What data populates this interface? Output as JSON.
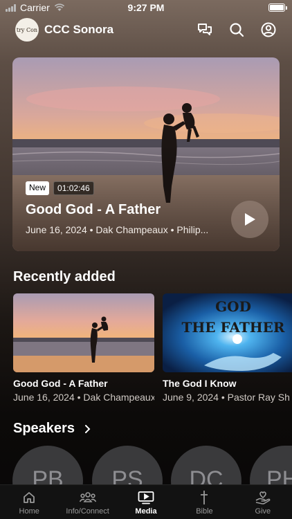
{
  "status_bar": {
    "carrier": "Carrier",
    "time": "9:27 PM",
    "battery_level": 1.0
  },
  "header": {
    "logo_text": "try Con",
    "title": "CCC Sonora",
    "icons": [
      "chat-icon",
      "search-icon",
      "profile-icon"
    ]
  },
  "featured": {
    "badge": "New",
    "duration": "01:02:46",
    "title": "Good God - A Father",
    "meta": "June 16, 2024 • Dak Champeaux • Philip..."
  },
  "recently_added": {
    "heading": "Recently added",
    "items": [
      {
        "title": "Good God - A Father",
        "meta": "June 16, 2024 • Dak Champeaux"
      },
      {
        "title": "The God I Know",
        "meta": "June 9, 2024 • Pastor Ray Sh",
        "thumb_text_line1": "GOD",
        "thumb_text_line2": "THE FATHER"
      }
    ]
  },
  "speakers": {
    "heading": "Speakers",
    "items": [
      "PB",
      "PS",
      "DC",
      "PH"
    ]
  },
  "nav": {
    "items": [
      {
        "label": "Home",
        "icon": "home-icon"
      },
      {
        "label": "Info/Connect",
        "icon": "people-icon"
      },
      {
        "label": "Media",
        "icon": "tv-play-icon"
      },
      {
        "label": "Bible",
        "icon": "cross-icon"
      },
      {
        "label": "Give",
        "icon": "heart-hand-icon"
      }
    ],
    "active": "Media"
  },
  "colors": {
    "accent": "#ffffff",
    "nav_inactive": "#9a9a9a",
    "speaker_bg": "#3a3a3c"
  }
}
